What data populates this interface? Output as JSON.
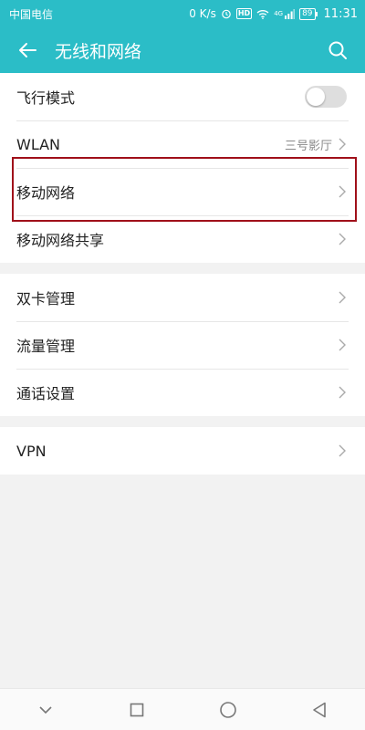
{
  "status_bar": {
    "carrier": "中国电信",
    "speed": "0 K/s",
    "hd": "HD",
    "signal": "4G",
    "battery": "89",
    "time": "11:31"
  },
  "app_bar": {
    "title": "无线和网络"
  },
  "groups": [
    {
      "items": [
        {
          "label": "飞行模式",
          "control": "toggle",
          "on": false
        },
        {
          "label": "WLAN",
          "value": "三号影厅"
        },
        {
          "label": "移动网络",
          "highlighted": true
        },
        {
          "label": "移动网络共享"
        }
      ]
    },
    {
      "items": [
        {
          "label": "双卡管理"
        },
        {
          "label": "流量管理"
        },
        {
          "label": "通话设置"
        }
      ]
    },
    {
      "items": [
        {
          "label": "VPN"
        }
      ]
    }
  ],
  "colors": {
    "accent": "#2bbdc7",
    "highlight": "#a0101a"
  }
}
